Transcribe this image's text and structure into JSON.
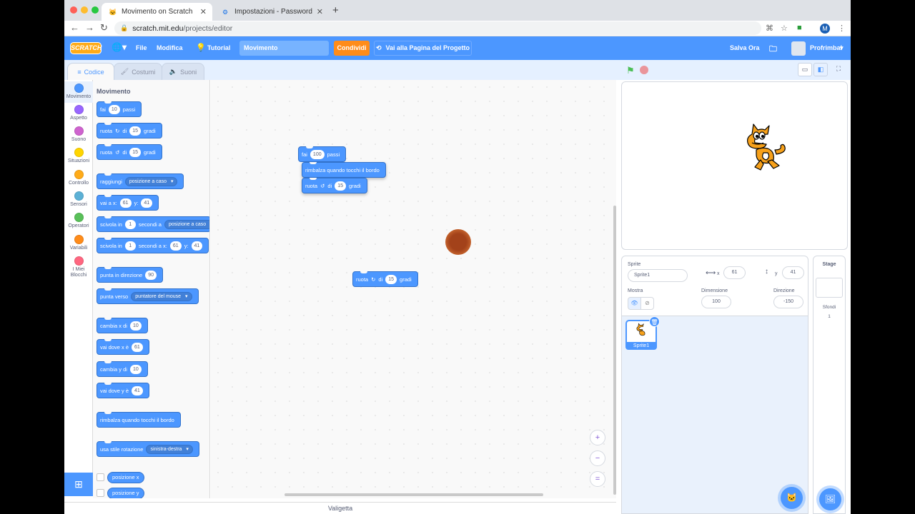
{
  "browser": {
    "tabs": [
      {
        "title": "Movimento on Scratch",
        "active": true
      },
      {
        "title": "Impostazioni - Password",
        "active": false
      }
    ],
    "new_tab": "+",
    "url_host": "scratch.mit.edu",
    "url_path": "/projects/editor",
    "account_initial": "M"
  },
  "menubar": {
    "logo": "SCRATCH",
    "file": "File",
    "edit": "Modifica",
    "tutorials": "Tutorial",
    "project_title": "Movimento",
    "share": "Condividi",
    "see_project": "Vai alla Pagina del Progetto",
    "save_now": "Salva Ora",
    "username": "Profrimbal"
  },
  "editor_tabs": {
    "code": "Codice",
    "costumes": "Costumi",
    "sounds": "Suoni"
  },
  "categories": [
    {
      "label": "Movimento",
      "color": "#4c97ff"
    },
    {
      "label": "Aspetto",
      "color": "#9966ff"
    },
    {
      "label": "Suono",
      "color": "#cf63cf"
    },
    {
      "label": "Situazioni",
      "color": "#ffd500"
    },
    {
      "label": "Controllo",
      "color": "#ffab19"
    },
    {
      "label": "Sensori",
      "color": "#5cb1d6"
    },
    {
      "label": "Operatori",
      "color": "#59c059"
    },
    {
      "label": "Variabili",
      "color": "#ff8c1a"
    },
    {
      "label": "I Miei Blocchi",
      "color": "#ff6680"
    }
  ],
  "palette": {
    "title": "Movimento",
    "move": {
      "a": "fai",
      "n": "10",
      "b": "passi"
    },
    "turn_right": {
      "a": "ruota",
      "b": "di",
      "n": "15",
      "c": "gradi"
    },
    "turn_left": {
      "a": "ruota",
      "b": "di",
      "n": "15",
      "c": "gradi"
    },
    "goto": {
      "a": "raggiungi",
      "dd": "posizione a caso"
    },
    "goto_xy": {
      "a": "vai a x:",
      "x": "61",
      "b": "y:",
      "y": "41"
    },
    "glide": {
      "a": "scivola in",
      "n": "1",
      "b": "secondi a",
      "dd": "posizione a caso"
    },
    "glide_xy": {
      "a": "scivola in",
      "n": "1",
      "b": "secondi a x:",
      "x": "61",
      "c": "y:",
      "y": "41"
    },
    "point_dir": {
      "a": "punta in direzione",
      "n": "90"
    },
    "point_towards": {
      "a": "punta verso",
      "dd": "puntatore del mouse"
    },
    "change_x": {
      "a": "cambia x di",
      "n": "10"
    },
    "set_x": {
      "a": "vai dove x è",
      "n": "61"
    },
    "change_y": {
      "a": "cambia y di",
      "n": "10"
    },
    "set_y": {
      "a": "vai dove y è",
      "n": "41"
    },
    "bounce": {
      "a": "rimbalza quando tocchi il bordo"
    },
    "rotation_style": {
      "a": "usa stile rotazione",
      "dd": "sinistra-destra"
    },
    "x_position": "posizione x",
    "y_position": "posizione y"
  },
  "script": {
    "move": {
      "a": "fai",
      "n": "100",
      "b": "passi"
    },
    "bounce": "rimbalza quando tocchi il bordo",
    "turn_left": {
      "a": "ruota",
      "b": "di",
      "n": "15",
      "c": "gradi"
    },
    "loose_turn_right": {
      "a": "ruota",
      "b": "di",
      "n": "15",
      "c": "gradi"
    }
  },
  "zoom": {
    "in": "+",
    "out": "−",
    "reset": "="
  },
  "backpack": "Valigetta",
  "sprite_info": {
    "sprite_label": "Sprite",
    "sprite_name": "Sprite1",
    "x_label": "x",
    "x_value": "61",
    "y_label": "y",
    "y_value": "41",
    "show_label": "Mostra",
    "size_label": "Dimensione",
    "size_value": "100",
    "direction_label": "Direzione",
    "direction_value": "-150"
  },
  "sprites": [
    {
      "name": "Sprite1",
      "selected": true
    }
  ],
  "stage_pane": {
    "title": "Stage",
    "backdrops_label": "Sfondi",
    "backdrops_count": "1"
  },
  "colors": {
    "motion": "#4c97ff",
    "scratch_blue": "#4c97ff",
    "share_orange": "#ff8c1a"
  }
}
